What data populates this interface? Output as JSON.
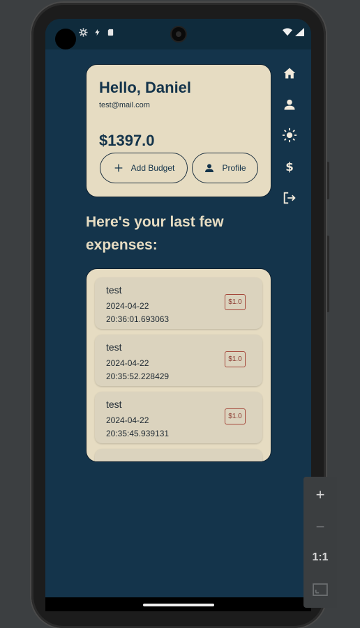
{
  "status_bar": {
    "icons": [
      "gear-icon",
      "bolt-icon",
      "sd-card-icon",
      "wifi-icon",
      "signal-icon"
    ]
  },
  "account": {
    "greeting": "Hello, Daniel",
    "email": "test@mail.com",
    "balance": "$1397.0",
    "add_budget_label": "Add Budget",
    "profile_label": "Profile"
  },
  "nav_rail": {
    "items": [
      "home-icon",
      "person-icon",
      "sun-icon",
      "dollar-icon",
      "logout-icon"
    ]
  },
  "expenses": {
    "heading": "Here's your last few expenses:",
    "items": [
      {
        "name": "test",
        "date": "2024-04-22",
        "time": "20:36:01.693063",
        "amount": "$1.0"
      },
      {
        "name": "test",
        "date": "2024-04-22",
        "time": "20:35:52.228429",
        "amount": "$1.0"
      },
      {
        "name": "test",
        "date": "2024-04-22",
        "time": "20:35:45.939131",
        "amount": "$1.0"
      }
    ]
  },
  "emulator_zoom": {
    "zoom_in": "+",
    "zoom_out": "−",
    "actual_size": "1:1"
  }
}
